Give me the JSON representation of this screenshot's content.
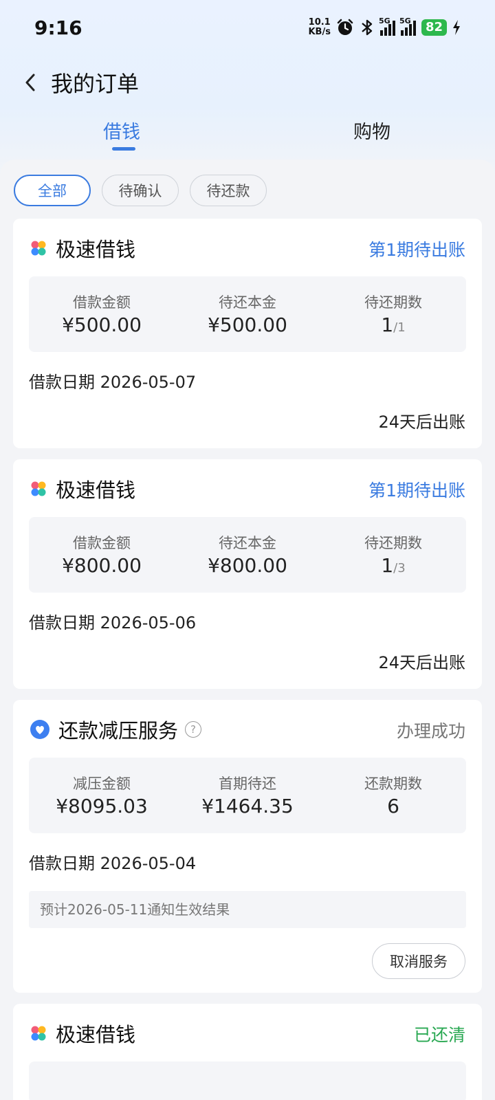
{
  "status_bar": {
    "time": "9:16",
    "net_speed_value": "10.1",
    "net_speed_unit": "KB/s",
    "signal_1": "5G",
    "signal_2": "5G",
    "battery": "82"
  },
  "header": {
    "back_label": "‹",
    "title": "我的订单"
  },
  "tabs": [
    {
      "label": "借钱",
      "active": true
    },
    {
      "label": "购物",
      "active": false
    }
  ],
  "filters": [
    "全部",
    "待确认",
    "待还款"
  ],
  "cards": [
    {
      "title": "极速借钱",
      "status": "第1期待出账",
      "status_color": "#3a7be0",
      "stats": [
        {
          "label": "借款金额",
          "value": "¥500.00"
        },
        {
          "label": "待还本金",
          "value": "¥500.00"
        },
        {
          "label": "待还期数",
          "value": "1",
          "sub": "/1"
        }
      ],
      "date_label": "借款日期",
      "date": "2026-05-07",
      "due": "24天后出账"
    },
    {
      "title": "极速借钱",
      "status": "第1期待出账",
      "status_color": "#3a7be0",
      "stats": [
        {
          "label": "借款金额",
          "value": "¥800.00"
        },
        {
          "label": "待还本金",
          "value": "¥800.00"
        },
        {
          "label": "待还期数",
          "value": "1",
          "sub": "/3"
        }
      ],
      "date_label": "借款日期",
      "date": "2026-05-06",
      "due": "24天后出账"
    },
    {
      "title": "还款减压服务",
      "status": "办理成功",
      "status_color": "#777777",
      "stats": [
        {
          "label": "减压金额",
          "value": "¥8095.03"
        },
        {
          "label": "首期待还",
          "value": "¥1464.35"
        },
        {
          "label": "还款期数",
          "value": "6"
        }
      ],
      "date_label": "借款日期",
      "date": "2026-05-04",
      "notice": "预计2026-05-11通知生效结果",
      "button": "取消服务"
    },
    {
      "title": "极速借钱",
      "status": "已还清",
      "status_color": "#2aa853"
    }
  ],
  "colors": {
    "accent": "#3a7be0",
    "success": "#2aa853",
    "background": "#f3f4f7"
  }
}
